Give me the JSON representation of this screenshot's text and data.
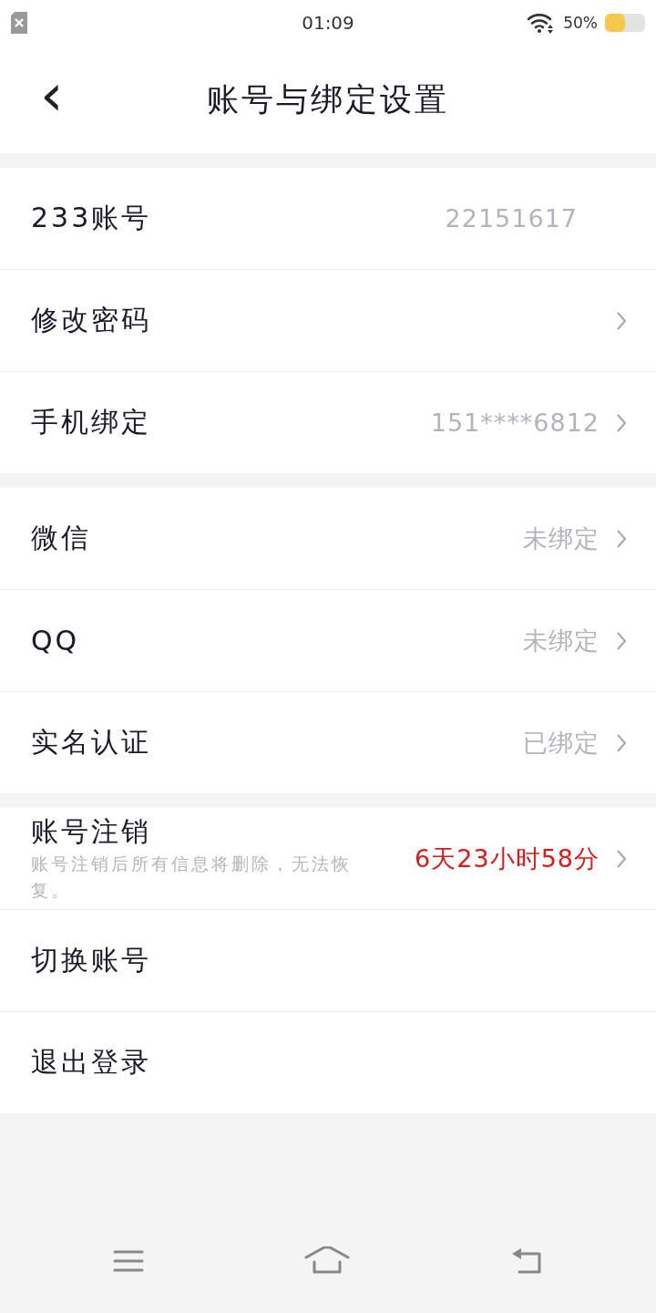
{
  "status_bar": {
    "time": "01:09",
    "battery": "50%"
  },
  "header": {
    "back": "‹",
    "title": "账号与绑定设置"
  },
  "sections": [
    {
      "rows": [
        {
          "label": "233账号",
          "value": "22151617",
          "alert": false,
          "chevron": false
        },
        {
          "label": "修改密码",
          "chevron": true
        },
        {
          "label": "手机绑定",
          "value": "151****6812",
          "alert": false,
          "chevron": true
        }
      ]
    },
    {
      "rows": [
        {
          "label": "微信",
          "value": "未绑定",
          "alert": false,
          "chevron": true
        },
        {
          "label": "QQ",
          "value": "未绑定",
          "alert": false,
          "chevron": true
        },
        {
          "label": "实名认证",
          "value": "已绑定",
          "alert": false,
          "chevron": true
        }
      ]
    },
    {
      "rows": [
        {
          "label": "账号注销",
          "subtitle": "账号注销后所有信息将删除，无法恢复。",
          "value": "6天23小时58分",
          "alert": true,
          "chevron": true
        },
        {
          "label": "切换账号",
          "chevron": false
        },
        {
          "label": "退出登录",
          "chevron": false
        }
      ]
    }
  ]
}
